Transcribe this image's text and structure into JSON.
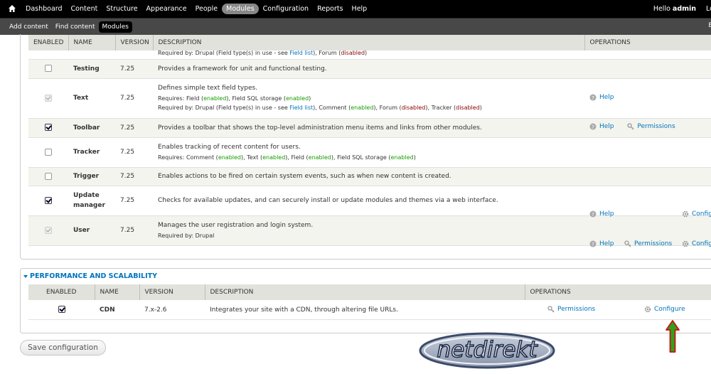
{
  "toolbar": {
    "menu": [
      "Dashboard",
      "Content",
      "Structure",
      "Appearance",
      "People",
      "Modules",
      "Configuration",
      "Reports",
      "Help"
    ],
    "active": "Modules",
    "greeting": "Hello",
    "user": "admin",
    "logout": "Lo"
  },
  "shortcuts": {
    "items": [
      "Add content",
      "Find content",
      "Modules"
    ],
    "active": "Modules",
    "edit": "E"
  },
  "core": {
    "headers": [
      "ENABLED",
      "NAME",
      "VERSION",
      "DESCRIPTION",
      "OPERATIONS"
    ],
    "clipped_text": {
      "pre": "Required by: Drupal (Field type(s) in use - see ",
      "link": "Field list",
      "mid": "), Forum (",
      "dis": "disabled",
      "post": ")"
    },
    "rows": [
      {
        "name": "Testing",
        "version": "7.25",
        "description": "Provides a framework for unit and functional testing.",
        "state": "unchecked"
      },
      {
        "name": "Text",
        "version": "7.25",
        "description": "Defines simple text field types.",
        "requires": {
          "label": "Requires: ",
          "items": [
            {
              "name": "Field",
              "status": "enabled"
            },
            {
              "name": "Field SQL storage",
              "status": "enabled"
            }
          ]
        },
        "required_by": {
          "label": "Required by: Drupal (Field type(s) in use - see ",
          "link": "Field list",
          "items": [
            {
              "name": "Comment",
              "status": "enabled"
            },
            {
              "name": "Forum",
              "status": "disabled"
            },
            {
              "name": "Tracker",
              "status": "disabled"
            }
          ]
        },
        "state": "disabled",
        "ops": {
          "help": "Help"
        }
      },
      {
        "name": "Toolbar",
        "version": "7.25",
        "description": "Provides a toolbar that shows the top-level administration menu items and links from other modules.",
        "state": "checked",
        "ops": {
          "help": "Help",
          "permissions": "Permissions"
        }
      },
      {
        "name": "Tracker",
        "version": "7.25",
        "description": "Enables tracking of recent content for users.",
        "requires": {
          "label": "Requires: ",
          "items": [
            {
              "name": "Comment",
              "status": "enabled"
            },
            {
              "name": "Text",
              "status": "enabled"
            },
            {
              "name": "Field",
              "status": "enabled"
            },
            {
              "name": "Field SQL storage",
              "status": "enabled"
            }
          ]
        },
        "state": "unchecked"
      },
      {
        "name": "Trigger",
        "version": "7.25",
        "description": "Enables actions to be fired on certain system events, such as when new content is created.",
        "state": "unchecked"
      },
      {
        "name_line1": "Update",
        "name_line2": "manager",
        "version": "7.25",
        "description": "Checks for available updates, and can securely install or update modules and themes via a web interface.",
        "state": "checked",
        "ops": {
          "help": "Help",
          "configure": "Configu"
        }
      },
      {
        "name": "User",
        "version": "7.25",
        "description": "Manages the user registration and login system.",
        "required_by_text": "Required by: Drupal",
        "state": "disabled",
        "ops": {
          "help": "Help",
          "permissions": "Permissions",
          "configure": "Configu"
        }
      }
    ]
  },
  "performance": {
    "legend": "PERFORMANCE AND SCALABILITY",
    "headers": [
      "ENABLED",
      "NAME",
      "VERSION",
      "DESCRIPTION",
      "OPERATIONS"
    ],
    "row": {
      "name": "CDN",
      "version": "7.x-2.6",
      "description": "Integrates your site with a CDN, through altering file URLs.",
      "state": "checked",
      "permissions": "Permissions",
      "configure": "Configure"
    }
  },
  "save_button": "Save configuration",
  "logo_text": "netdirekt",
  "colors": {
    "link": "#0074bd",
    "enabled": "#159b00",
    "disabled": "#8b0000",
    "arrow_fill": "#2fa11c",
    "arrow_border": "#cc1111"
  }
}
